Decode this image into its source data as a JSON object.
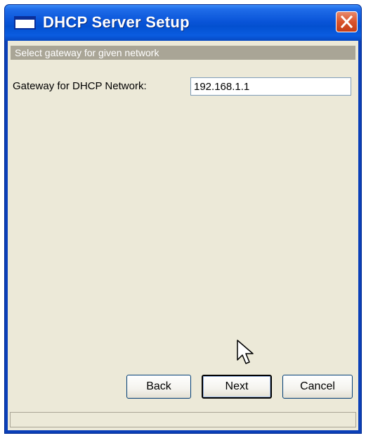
{
  "window": {
    "title": "DHCP Server Setup",
    "close_icon": "close-x-icon",
    "app_icon": "window-icon"
  },
  "header": {
    "text": "Select gateway for given network"
  },
  "form": {
    "gateway_label": "Gateway for DHCP Network:",
    "gateway_value": "192.168.1.1"
  },
  "buttons": {
    "back": "Back",
    "next": "Next",
    "cancel": "Cancel"
  },
  "status": {
    "text": ""
  },
  "cursor": "arrow-cursor-icon",
  "colors": {
    "titlebar": "#0a55d9",
    "dialog_background": "#ece9d8",
    "header_bar": "#a9a596",
    "close_button": "#d9542c"
  }
}
